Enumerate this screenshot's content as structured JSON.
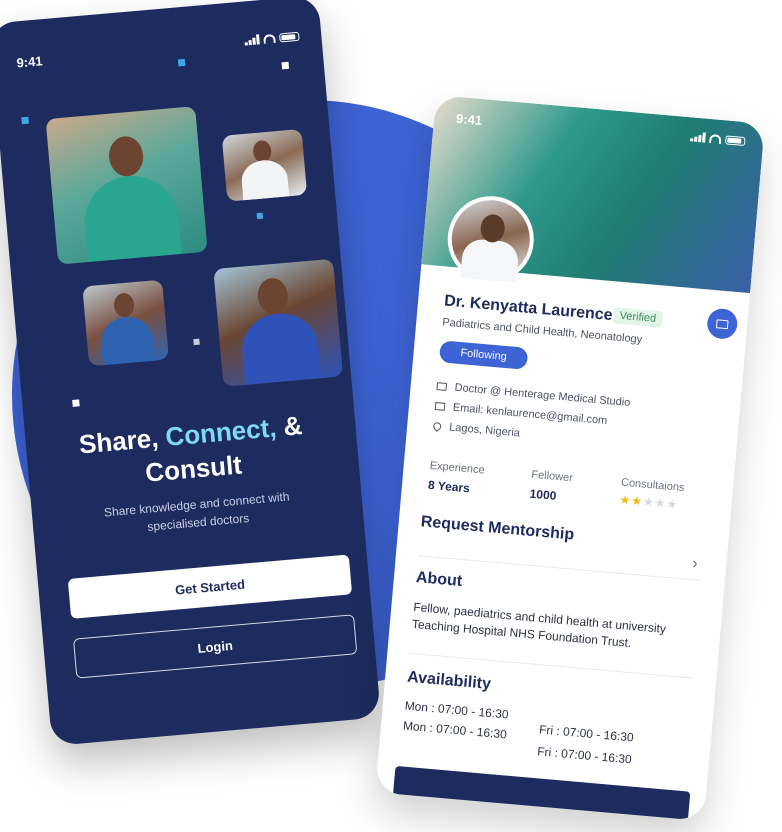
{
  "onboarding": {
    "status_time": "9:41",
    "title_part1": "Share, ",
    "title_accent": "Connect,",
    "title_part2": " & Consult",
    "subtitle": "Share knowledge and connect with specialised doctors",
    "get_started_label": "Get Started",
    "login_label": "Login"
  },
  "profile": {
    "status_time": "9:41",
    "name": "Dr. Kenyatta Laurence",
    "verified_label": "Verified",
    "specialty": "Padiatrics and Child Health, Neonatology",
    "following_label": "Following",
    "workplace": "Doctor @ Henterage Medical Studio",
    "email": "Email: kenlaurence@gmail.com",
    "location": "Lagos, Nigeria",
    "stats": {
      "experience_label": "Experience",
      "experience_value": "8 Years",
      "fellower_label": "Fellower",
      "fellower_value": "1000",
      "consultations_label": "Consultaions",
      "consultations_rating": 2,
      "consultations_rating_max": 5
    },
    "request_mentorship_label": "Request Mentorship",
    "about_title": "About",
    "about_text": "Fellow, paediatrics and child health at university Teaching Hospital NHS Foundation Trust.",
    "availability_title": "Availability",
    "availability": [
      "Mon : 07:00 - 16:30",
      "Fri : 07:00 - 16:30",
      "Mon : 07:00 - 16:30",
      "Fri : 07:00 - 16:30"
    ]
  },
  "colors": {
    "navy": "#1d2b5e",
    "blue": "#3d63d4",
    "accent_cyan": "#7fd8f4",
    "star": "#f2b90f"
  }
}
